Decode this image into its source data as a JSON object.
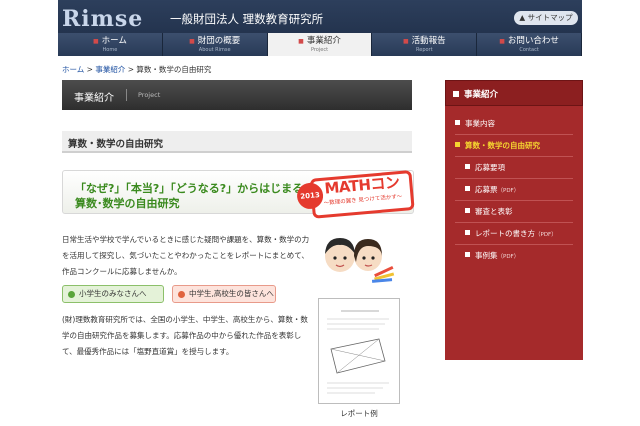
{
  "header": {
    "logo": "Rimse",
    "org_name": "一般財団法人 理数教育研究所",
    "sitemap_label": "サイトマップ"
  },
  "nav": {
    "items": [
      {
        "label": "ホーム",
        "sub": "Home"
      },
      {
        "label": "財団の概要",
        "sub": "About Rimse"
      },
      {
        "label": "事業紹介",
        "sub": "Project"
      },
      {
        "label": "活動報告",
        "sub": "Report"
      },
      {
        "label": "お問い合わせ",
        "sub": "Contact"
      }
    ],
    "active_index": 2
  },
  "breadcrumb": {
    "home": "ホーム",
    "sep1": " > ",
    "section": "事業紹介",
    "sep2": " > ",
    "current": "算数・数学の自由研究"
  },
  "section_bar": {
    "title": "事業紹介",
    "sub": "Project"
  },
  "page_title": "算数・数学の自由研究",
  "banner": {
    "line1": "「なぜ?」「本当?」「どうなる?」からはじまる",
    "line2": "算数･数学の自由研究",
    "badge_year": "2013",
    "badge_title": "MATHコン",
    "badge_sub": "〜数理の翼き 見つけて活かす〜"
  },
  "intro_text": "日常生活や学校で学んでいるときに感じた疑問や課題を、算数・数学の力を活用して探究し、気づいたことやわかったことをレポートにまとめて、作品コンクールに応募しませんか。",
  "tabs": {
    "elementary": "小学生のみなさんへ",
    "secondary": "中学生,高校生の皆さんへ"
  },
  "body_text": "(財)理数教育研究所では、全国の小学生、中学生、高校生から、算数・数学の自由研究作品を募集します。応募作品の中から優れた作品を表彰して、最優秀作品には「塩野直道賞」を授与します。",
  "report_caption": "レポート例",
  "sidebar": {
    "title": "事業紹介",
    "items": [
      {
        "label": "事業内容",
        "pdf": ""
      },
      {
        "label": "算数・数学の自由研究",
        "pdf": ""
      },
      {
        "label": "応募要項",
        "pdf": ""
      },
      {
        "label": "応募票",
        "pdf": "（PDF）"
      },
      {
        "label": "審査と表彰",
        "pdf": ""
      },
      {
        "label": "レポートの書き方",
        "pdf": "（PDF）"
      },
      {
        "label": "事例集",
        "pdf": "（PDF）"
      }
    ]
  },
  "colors": {
    "header_bg": "#1d2c45",
    "sidebar_bg": "#a52a2b",
    "sidebar_current": "#f5d530",
    "banner_green": "#3a8a1e",
    "badge_red": "#e53a2e"
  }
}
